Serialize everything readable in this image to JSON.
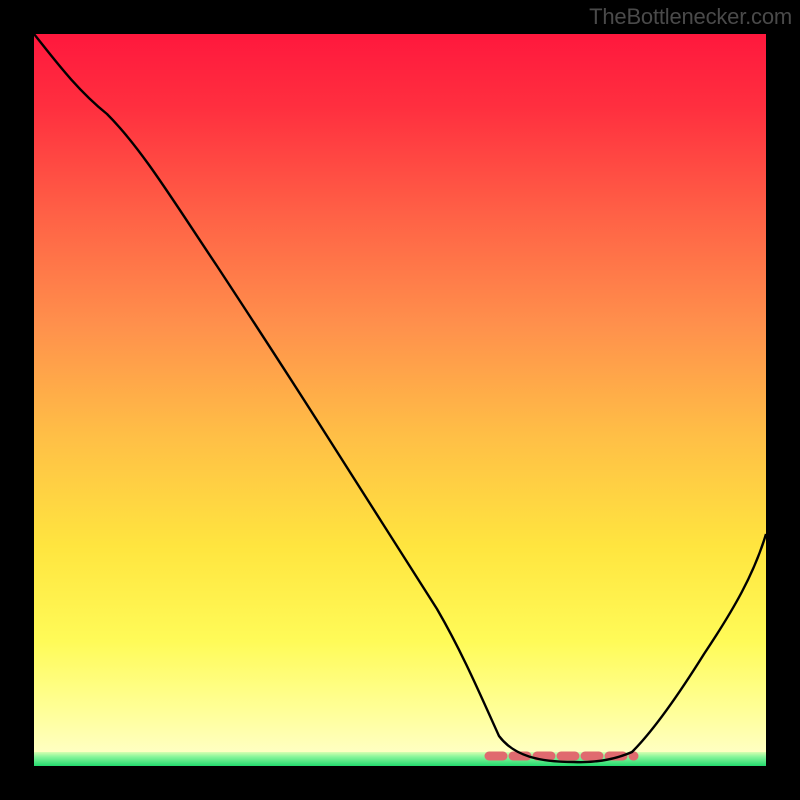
{
  "watermark": "TheBottlenecker.com",
  "chart_data": {
    "type": "line",
    "title": "",
    "xlabel": "",
    "ylabel": "",
    "xlim": [
      0,
      100
    ],
    "ylim": [
      0,
      100
    ],
    "x": [
      0,
      5,
      10,
      15,
      20,
      25,
      30,
      35,
      40,
      45,
      50,
      55,
      60,
      62,
      65,
      68,
      72,
      76,
      79,
      82,
      85,
      90,
      95,
      100
    ],
    "values": [
      100,
      95,
      89,
      81,
      73,
      65,
      57,
      49,
      41,
      33,
      25,
      17,
      10,
      6,
      3,
      1,
      0.5,
      0.5,
      0.8,
      2,
      5,
      13,
      22,
      32
    ],
    "flat_segment_x": [
      62,
      82
    ],
    "pink_marker_band_y": [
      0,
      2
    ],
    "green_band_y": [
      0,
      1.5
    ],
    "background": "vertical gradient red→orange→yellow→lightyellow"
  }
}
